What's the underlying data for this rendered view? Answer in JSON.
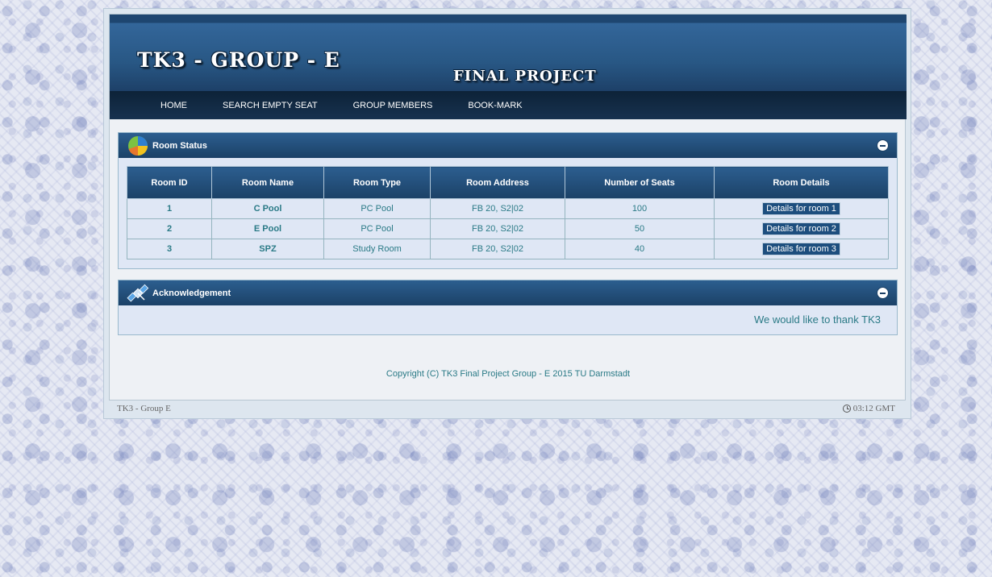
{
  "header": {
    "title": "TK3 - GROUP - E",
    "subtitle": "FINAL PROJECT"
  },
  "nav": {
    "items": [
      {
        "label": "HOME"
      },
      {
        "label": "SEARCH EMPTY SEAT"
      },
      {
        "label": "GROUP MEMBERS"
      },
      {
        "label": "BOOK-MARK"
      }
    ]
  },
  "room_status": {
    "title": "Room Status",
    "icon": "pie-chart-icon",
    "columns": [
      "Room ID",
      "Room Name",
      "Room Type",
      "Room Address",
      "Number of Seats",
      "Room Details"
    ],
    "rows": [
      {
        "id": "1",
        "name": "C Pool",
        "type": "PC Pool",
        "address": "FB 20, S2|02",
        "seats": "100",
        "details": "Details for room 1"
      },
      {
        "id": "2",
        "name": "E Pool",
        "type": "PC Pool",
        "address": "FB 20, S2|02",
        "seats": "50",
        "details": "Details for room 2"
      },
      {
        "id": "3",
        "name": "SPZ",
        "type": "Study Room",
        "address": "FB 20, S2|02",
        "seats": "40",
        "details": "Details for room 3"
      }
    ]
  },
  "acknowledgement": {
    "title": "Acknowledgement",
    "icon": "satellite-icon",
    "text": "We would like to thank TK3"
  },
  "copyright": "Copyright (C) TK3 Final Project Group - E 2015 TU Darmstadt",
  "footer": {
    "left": "TK3 - Group E",
    "time": "03:12 GMT"
  },
  "colors": {
    "header_blue": "#285784",
    "nav_dark": "#0d2238",
    "text_teal": "#2a7a86",
    "button_blue": "#1d4e7e"
  }
}
